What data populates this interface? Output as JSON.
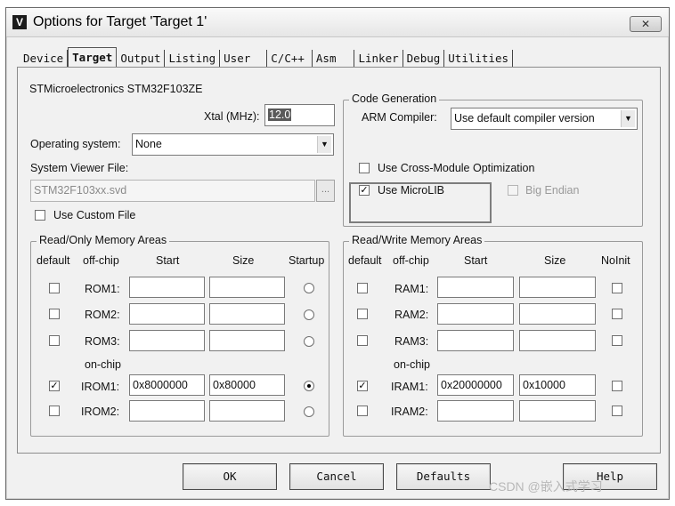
{
  "window": {
    "title": "Options for Target 'Target 1'",
    "close_glyph": "✕"
  },
  "tabs": [
    "Device",
    "Target",
    "Output",
    "Listing",
    "User",
    "C/C++",
    "Asm",
    "Linker",
    "Debug",
    "Utilities"
  ],
  "device": "STMicroelectronics STM32F103ZE",
  "xtal": {
    "label": "Xtal (MHz):",
    "value": "12.0"
  },
  "os": {
    "label": "Operating system:",
    "value": "None"
  },
  "svd": {
    "label": "System Viewer File:",
    "value": "STM32F103xx.svd",
    "browse": "..."
  },
  "use_custom_file": {
    "label": "Use Custom File",
    "checked": false
  },
  "codegen": {
    "title": "Code Generation",
    "compiler_label": "ARM Compiler:",
    "compiler_value": "Use default compiler version",
    "cross_module": {
      "label": "Use Cross-Module Optimization",
      "checked": false
    },
    "microlib": {
      "label": "Use MicroLIB",
      "checked": true,
      "check_glyph": "✓"
    },
    "big_endian": {
      "label": "Big Endian",
      "checked": false
    }
  },
  "rom_group": {
    "title": "Read/Only Memory Areas",
    "headers": {
      "default": "default",
      "offchip": "off-chip",
      "start": "Start",
      "size": "Size",
      "startup": "Startup"
    },
    "onchip_label": "on-chip",
    "rows": [
      {
        "name": "ROM1:",
        "start": "",
        "size": "",
        "default": false,
        "startup": false
      },
      {
        "name": "ROM2:",
        "start": "",
        "size": "",
        "default": false,
        "startup": false
      },
      {
        "name": "ROM3:",
        "start": "",
        "size": "",
        "default": false,
        "startup": false
      },
      {
        "name": "IROM1:",
        "start": "0x8000000",
        "size": "0x80000",
        "default": true,
        "startup": true
      },
      {
        "name": "IROM2:",
        "start": "",
        "size": "",
        "default": false,
        "startup": false
      }
    ]
  },
  "ram_group": {
    "title": "Read/Write Memory Areas",
    "headers": {
      "default": "default",
      "offchip": "off-chip",
      "start": "Start",
      "size": "Size",
      "noinit": "NoInit"
    },
    "onchip_label": "on-chip",
    "rows": [
      {
        "name": "RAM1:",
        "start": "",
        "size": "",
        "default": false,
        "noinit": false
      },
      {
        "name": "RAM2:",
        "start": "",
        "size": "",
        "default": false,
        "noinit": false
      },
      {
        "name": "RAM3:",
        "start": "",
        "size": "",
        "default": false,
        "noinit": false
      },
      {
        "name": "IRAM1:",
        "start": "0x20000000",
        "size": "0x10000",
        "default": true,
        "noinit": false
      },
      {
        "name": "IRAM2:",
        "start": "",
        "size": "",
        "default": false,
        "noinit": false
      }
    ]
  },
  "buttons": {
    "ok": "OK",
    "cancel": "Cancel",
    "defaults": "Defaults",
    "help": "Help"
  },
  "watermark": "CSDN @嵌入式学习"
}
